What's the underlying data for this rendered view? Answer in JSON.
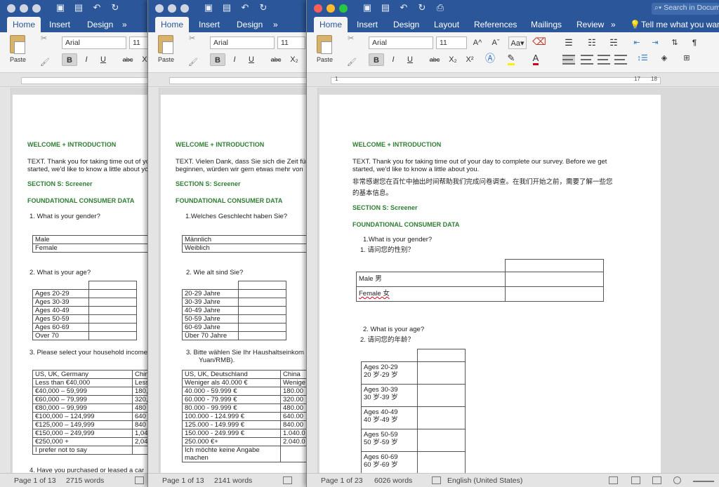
{
  "qa_icons": [
    "sidebar-icon",
    "save-icon",
    "undo-icon",
    "redo-icon",
    "print-icon"
  ],
  "ribbon": {
    "paste_label": "Paste",
    "font_name": "Arial",
    "font_size": "11",
    "bold": "B",
    "italic": "I",
    "underline": "U",
    "strike": "abc",
    "subscript": "X₂",
    "superscript": "X²",
    "grow_font": "A^",
    "shrink_font": "Aˇ"
  },
  "tabs_short": {
    "home": "Home",
    "insert": "Insert",
    "design": "Design",
    "more": "»"
  },
  "tabs_full": {
    "home": "Home",
    "insert": "Insert",
    "design": "Design",
    "layout": "Layout",
    "references": "References",
    "mailings": "Mailings",
    "review": "Review",
    "more": "»",
    "tell_me": "Tell me what you want"
  },
  "search_placeholder": "Search in Document",
  "win1": {
    "heading": "WELCOME + INTRODUCTION",
    "intro_line1": "TEXT. Thank you for taking time out of your day to complete our survey.",
    "intro_line2": "started, we'd like to know a little about you.",
    "section": "SECTION S: Screener",
    "foundational": "FOUNDATIONAL CONSUMER DATA",
    "q1": "1.   What is your gender?",
    "gender": [
      "Male",
      "Female"
    ],
    "q2": "2.  What is your age?",
    "ages": [
      "Ages 20-29",
      "Ages 30-39",
      "Ages 40-49",
      "Ages 50-59",
      "Ages 60-69",
      "Over 70"
    ],
    "q3": "3.  Please select your household income",
    "income_header": [
      "US, UK, Germany",
      "China"
    ],
    "income": [
      [
        "Less than €40,000",
        "Less"
      ],
      [
        "€40,000 – 59,999",
        "180,"
      ],
      [
        "€60,000 – 79,999",
        "320,"
      ],
      [
        "€80,000 – 99,999",
        "480"
      ],
      [
        "€100,000 – 124,999",
        "640"
      ],
      [
        "€125,000 – 149,999",
        "840"
      ],
      [
        "€150,000 – 249,999",
        "1,04"
      ],
      [
        "€250,000 +",
        "2,04"
      ],
      [
        "I prefer not to say",
        ""
      ]
    ],
    "q4": "4.  Have you purchased or leased a car",
    "status_page": "Page 1 of 13",
    "status_words": "2715 words"
  },
  "win2": {
    "heading": "WELCOME + INTRODUCTION",
    "intro_line1": "TEXT. Vielen Dank, dass Sie sich die Zeit für",
    "intro_line2": "beginnen, würden wir gern etwas mehr von",
    "section": "SECTION S: Screener",
    "foundational": "FOUNDATIONAL CONSUMER DATA",
    "q1": "1.Welches Geschlecht haben Sie?",
    "gender": [
      "Männlich",
      "Weiblich"
    ],
    "q2": "2.    Wie alt sind Sie?",
    "ages": [
      "20-29 Jahre",
      "30-39 Jahre",
      "40-49 Jahre",
      "50-59 Jahre",
      "60-69 Jahre",
      "Über 70 Jahre"
    ],
    "q3_line1": "3.    Bitte wählen Sie Ihr Haushaltseinkom",
    "q3_line2": "Yuan/RMB).",
    "income_header": [
      "US, UK, Deutschland",
      "China"
    ],
    "income": [
      [
        "Weniger als 40.000 €",
        "Wenige"
      ],
      [
        "40.000 - 59.999 €",
        "180.00"
      ],
      [
        "60.000 - 79.999 €",
        "320.00"
      ],
      [
        "80.000 - 99.999 €",
        "480.00"
      ],
      [
        "100.000 - 124.999 €",
        "640.00"
      ],
      [
        "125.000 - 149.999 €",
        "840.00"
      ],
      [
        "150.000 - 249.999 €",
        "1.040.0"
      ],
      [
        "250.000 €+",
        "2.040.0"
      ],
      [
        "Ich möchte keine Angabe",
        ""
      ],
      [
        "machen",
        ""
      ]
    ],
    "status_page": "Page 1 of 13",
    "status_words": "2141 words"
  },
  "win3": {
    "heading": "WELCOME + INTRODUCTION",
    "intro_line1": "TEXT. Thank you for taking time out of your day to complete our survey. Before we get",
    "intro_line2": "started, we'd like to know a little about you.",
    "intro_cn1": "非常感谢您在百忙中抽出时间帮助我们完成问卷调查。在我们开始之前，需要了解一些您",
    "intro_cn2": "的基本信息。",
    "section": "SECTION S: Screener",
    "foundational": "FOUNDATIONAL CONSUMER DATA",
    "q1_en": "1.What is your gender?",
    "q1_cn": "1. 请问您的性别？",
    "gender": [
      "Male  男",
      "Female  女"
    ],
    "q2_en": "2.   What is your age?",
    "q2_cn": "2. 请问您的年龄？",
    "ages": [
      [
        "Ages 20-29",
        "20 岁-29 岁"
      ],
      [
        "Ages 30-39",
        "30 岁-39 岁"
      ],
      [
        "Ages 40-49",
        "40 岁-49 岁"
      ],
      [
        "Ages 50-59",
        "50 岁-59 岁"
      ],
      [
        "Ages 60-69",
        "60 岁-69 岁"
      ]
    ],
    "status_page": "Page 1 of 23",
    "status_words": "6026 words",
    "status_lang": "English (United States)"
  }
}
